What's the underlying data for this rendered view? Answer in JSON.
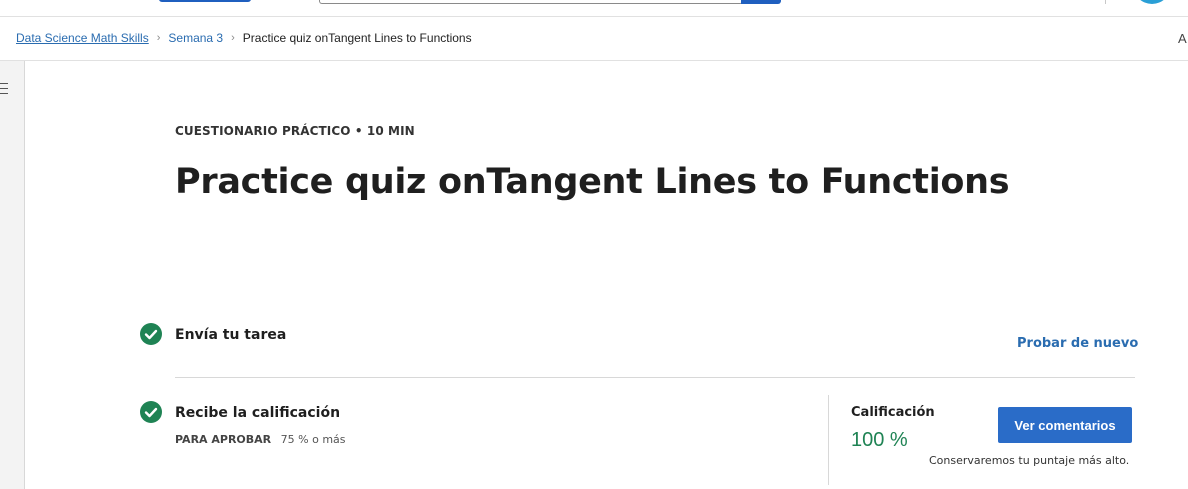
{
  "breadcrumb": {
    "items": [
      "Data Science Math Skills",
      "Semana 3"
    ],
    "current": "Practice quiz onTangent Lines to Functions",
    "right_glyph": "A"
  },
  "quiz": {
    "eyebrow": "CUESTIONARIO PRÁCTICO • 10 MIN",
    "title": "Practice quiz onTangent Lines to Functions"
  },
  "steps": {
    "submit": {
      "label": "Envía tu tarea",
      "retry_label": "Probar de nuevo"
    },
    "grade": {
      "label": "Recibe la calificación",
      "pass_label": "PARA APROBAR",
      "pass_value": "75 % o más",
      "grade_title": "Calificación",
      "grade_value": "100 %",
      "feedback_label": "Ver comentarios",
      "keep_note": "Conservaremos tu puntaje más alto."
    }
  },
  "colors": {
    "success": "#1f8354",
    "link": "#2a6cb0",
    "primary_button": "#2a6cc8"
  },
  "icons": {
    "check": "check-circle-icon",
    "menu": "hamburger-menu-icon",
    "chevron": "chevron-right-icon"
  }
}
